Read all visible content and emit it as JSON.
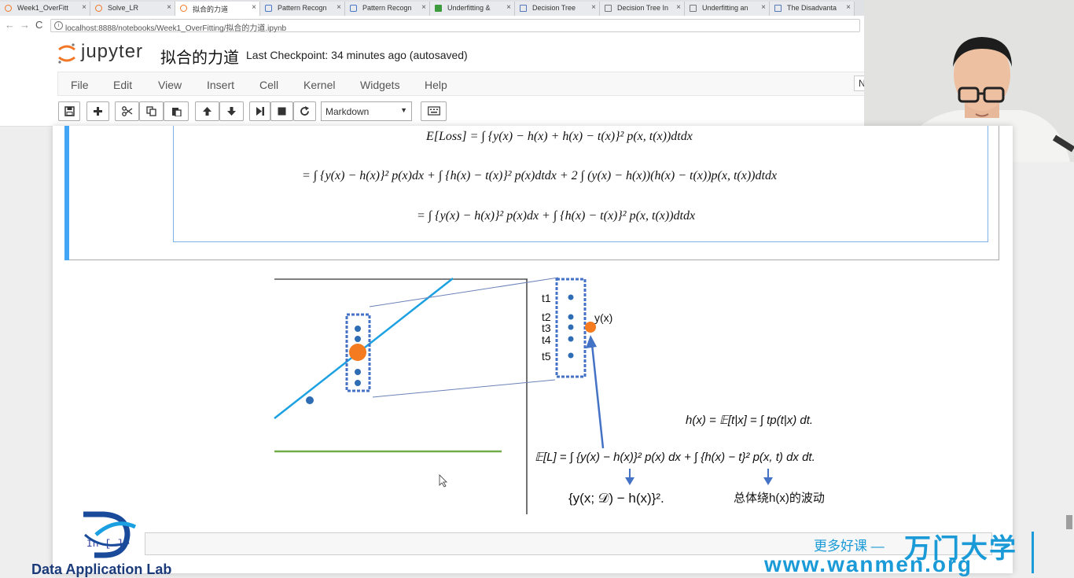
{
  "tabs": [
    {
      "title": "Week1_OverFitt",
      "icon": "jupyter-icon"
    },
    {
      "title": "Solve_LR",
      "icon": "jupyter-icon"
    },
    {
      "title": "拟合的力道",
      "icon": "jupyter-icon"
    },
    {
      "title": "Pattern Recogn",
      "icon": "gear-icon"
    },
    {
      "title": "Pattern Recogn",
      "icon": "gear-icon"
    },
    {
      "title": "Underfitting &",
      "icon": "stackexchange-icon"
    },
    {
      "title": "Decision Tree",
      "icon": "page-icon"
    },
    {
      "title": "Decision Tree In",
      "icon": "page-icon"
    },
    {
      "title": "Underfitting an",
      "icon": "page-icon"
    },
    {
      "title": "The Disadvanta",
      "icon": "page-icon"
    }
  ],
  "close_glyph": "×",
  "address": {
    "url": "localhost:8888/notebooks/Week1_OverFitting/拟合的力道.ipynb",
    "info": "i"
  },
  "nav": {
    "back": "←",
    "forward": "→",
    "reload": "C"
  },
  "header": {
    "app_name": "jupyter",
    "notebook_name": "拟合的力道",
    "checkpoint": "Last Checkpoint: 34 minutes ago (autosaved)"
  },
  "menu": [
    "File",
    "Edit",
    "View",
    "Insert",
    "Cell",
    "Kernel",
    "Widgets",
    "Help"
  ],
  "kernel_box": "N",
  "toolbar": {
    "cell_type": "Markdown",
    "buttons": [
      "save-icon",
      "plus-icon",
      "cut-icon",
      "copy-icon",
      "paste-icon",
      "arrow-up-icon",
      "arrow-down-icon",
      "run-icon",
      "stop-icon",
      "restart-icon",
      "keyboard-icon"
    ]
  },
  "equations": {
    "line1": "E[Loss] = ∫ {y(x) − h(x) + h(x) − t(x)}² p(x, t(x))dtdx",
    "line2": "= ∫ {y(x) − h(x)}² p(x)dx + ∫ {h(x) − t(x)}² p(x)dtdx + 2 ∫ (y(x) − h(x))(h(x) − t(x))p(x, t(x))dtdx",
    "line3": "= ∫ {y(x) − h(x)}² p(x)dx + ∫ {h(x) − t(x)}² p(x, t(x))dtdx"
  },
  "figure": {
    "t_labels": [
      "t1",
      "t2",
      "t3",
      "t4",
      "t5"
    ],
    "yx_label": "y(x)",
    "hx_formula": "h(x) = 𝔼[t|x] = ∫ tp(t|x) dt.",
    "expected_loss": "𝔼[L] = ∫ {y(x) − h(x)}² p(x) dx + ∫ {h(x) − t}² p(x, t) dx dt.",
    "variance_term": "{y(x; 𝒟) − h(x)}².",
    "noise_note": "总体绕h(x)的波动",
    "accent_blue": "#1ba1e2",
    "accent_orange": "#f47b20",
    "accent_green": "#70ad47",
    "box_blue": "#4472c4"
  },
  "bottom": {
    "prompt": "In [ ]:",
    "lab_name": "Data Application Lab",
    "watermark_cn": "更多好课 —",
    "watermark_logo": "万门大学",
    "watermark_url": "www.wanmen.org"
  }
}
